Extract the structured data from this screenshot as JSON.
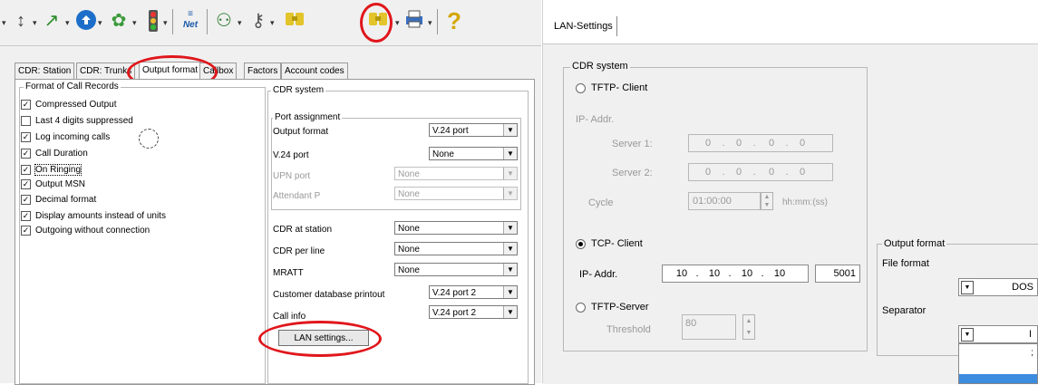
{
  "left": {
    "toolbar": {
      "icons": [
        "wand-icon",
        "phone-list-icon",
        "transfer-icon",
        "globe-icon",
        "puzzle-icon",
        "traffic-light-icon",
        "net-icon",
        "network-icon",
        "keys-icon",
        "cdr-icon",
        "printer-icon",
        "help-icon"
      ]
    },
    "tabs": [
      "CDR: Station",
      "CDR: Trunks",
      "Output format",
      "Callbox",
      "Factors",
      "Account codes"
    ],
    "format_group": {
      "legend": "Format of Call Records",
      "items": [
        {
          "label": "Compressed Output",
          "checked": true
        },
        {
          "label": "Last 4 digits suppressed",
          "checked": false
        },
        {
          "label": "Log incoming calls",
          "checked": true
        },
        {
          "label": "Call Duration",
          "checked": true
        },
        {
          "label": "On Ringing",
          "checked": true
        },
        {
          "label": "Output MSN",
          "checked": true
        },
        {
          "label": "Decimal format",
          "checked": true
        },
        {
          "label": "Display amounts instead of units",
          "checked": true
        },
        {
          "label": "Outgoing without connection",
          "checked": true
        }
      ]
    },
    "cdr_system": {
      "legend": "CDR system",
      "port_legend": "Port assignment",
      "output_format_label": "Output format",
      "output_format_value": "V.24 port",
      "v24_label": "V.24 port",
      "v24_value": "None",
      "upn_label": "UPN port",
      "upn_value": "None",
      "attendant_label": "Attendant P",
      "attendant_value": "None",
      "cdr_station_label": "CDR at station",
      "cdr_station_value": "None",
      "cdr_line_label": "CDR per line",
      "cdr_line_value": "None",
      "mratt_label": "MRATT",
      "mratt_value": "None",
      "customer_db_label": "Customer database printout",
      "customer_db_value": "V.24 port 2",
      "call_info_label": "Call info",
      "call_info_value": "V.24 port 2",
      "lan_button": "LAN settings..."
    }
  },
  "right": {
    "tab": "LAN-Settings",
    "cdr_system": {
      "legend": "CDR system",
      "tftp_client": "TFTP- Client",
      "ip_addr_label": "IP- Addr.",
      "server1_label": "Server 1:",
      "server1": [
        "0",
        "0",
        "0",
        "0"
      ],
      "server2_label": "Server 2:",
      "server2": [
        "0",
        "0",
        "0",
        "0"
      ],
      "cycle_label": "Cycle",
      "cycle_value": "01:00:00",
      "cycle_unit": "hh:mm:(ss)",
      "tcp_client": "TCP- Client",
      "tcp_ip_label": "IP- Addr.",
      "tcp_ip": [
        "10",
        "10",
        "10",
        "10"
      ],
      "tcp_port": "5001",
      "tftp_server": "TFTP-Server",
      "threshold_label": "Threshold",
      "threshold_value": "80"
    },
    "output_format": {
      "legend": "Output format",
      "file_format_label": "File format",
      "file_format_value": "DOS",
      "separator_label": "Separator",
      "separator_value": "I",
      "dropdown_options": [
        ";",
        ""
      ]
    }
  },
  "colors": {
    "highlight_red": "#e0161b",
    "selection_blue": "#3c8ce0"
  }
}
